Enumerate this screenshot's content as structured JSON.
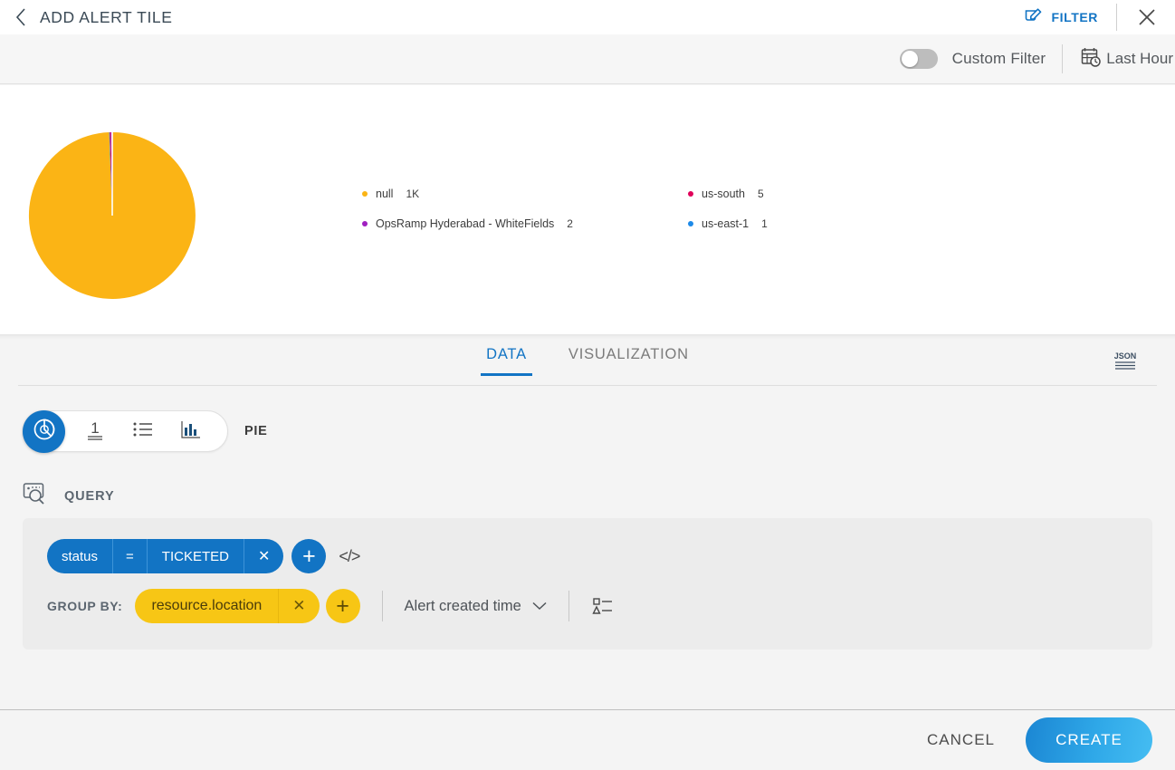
{
  "header": {
    "title": "ADD ALERT TILE",
    "back_icon": "chevron-left-icon",
    "filter_label": "FILTER",
    "filter_icon": "edit-filter-icon",
    "close_icon": "close-icon"
  },
  "filterbar": {
    "toggle_state": "off",
    "custom_filter_label": "Custom Filter",
    "time_range_label": "Last Hour",
    "time_range_icon": "calendar-clock-icon"
  },
  "chart_data": {
    "type": "pie",
    "title": "",
    "categories": [
      "null",
      "OpsRamp Hyderabad - WhiteFields",
      "us-south",
      "us-east-1"
    ],
    "values": [
      1000,
      2,
      5,
      1
    ],
    "value_labels": [
      "1K",
      "2",
      "5",
      "1"
    ],
    "colors": [
      "#fbb415",
      "#a020c0",
      "#e0005a",
      "#1d8ae8"
    ],
    "legend_position": "right",
    "grid": false
  },
  "tabs": [
    {
      "label": "DATA",
      "active": true
    },
    {
      "label": "VISUALIZATION",
      "active": false
    }
  ],
  "json_button": {
    "label": "JSON",
    "icon": "json-icon"
  },
  "type_selector": {
    "active_icon": "pie-chart-icon",
    "options": [
      {
        "icon": "single-value-icon",
        "label": "1"
      },
      {
        "icon": "list-icon",
        "label": ""
      },
      {
        "icon": "bar-chart-icon",
        "label": ""
      }
    ],
    "active_label": "PIE"
  },
  "query": {
    "section_icon": "query-search-icon",
    "section_label": "QUERY",
    "filter_chip": {
      "field": "status",
      "operator": "=",
      "value": "TICKETED",
      "remove_icon": "close-icon"
    },
    "add_filter_icon": "plus-icon",
    "code_icon": "code-icon",
    "group_by_label": "GROUP BY:",
    "group_by_chip": {
      "value": "resource.location",
      "remove_icon": "close-icon"
    },
    "add_group_icon": "plus-icon",
    "time_field": "Alert created time",
    "time_field_icon": "chevron-down-icon",
    "sort_icon": "sort-legend-icon"
  },
  "footer": {
    "cancel_label": "CANCEL",
    "create_label": "CREATE"
  },
  "colors": {
    "accent_blue": "#1274c4",
    "accent_yellow": "#f7c615",
    "amber": "#fbb415",
    "purple": "#a020c0",
    "crimson": "#e0005a",
    "blue_dot": "#1d8ae8"
  }
}
